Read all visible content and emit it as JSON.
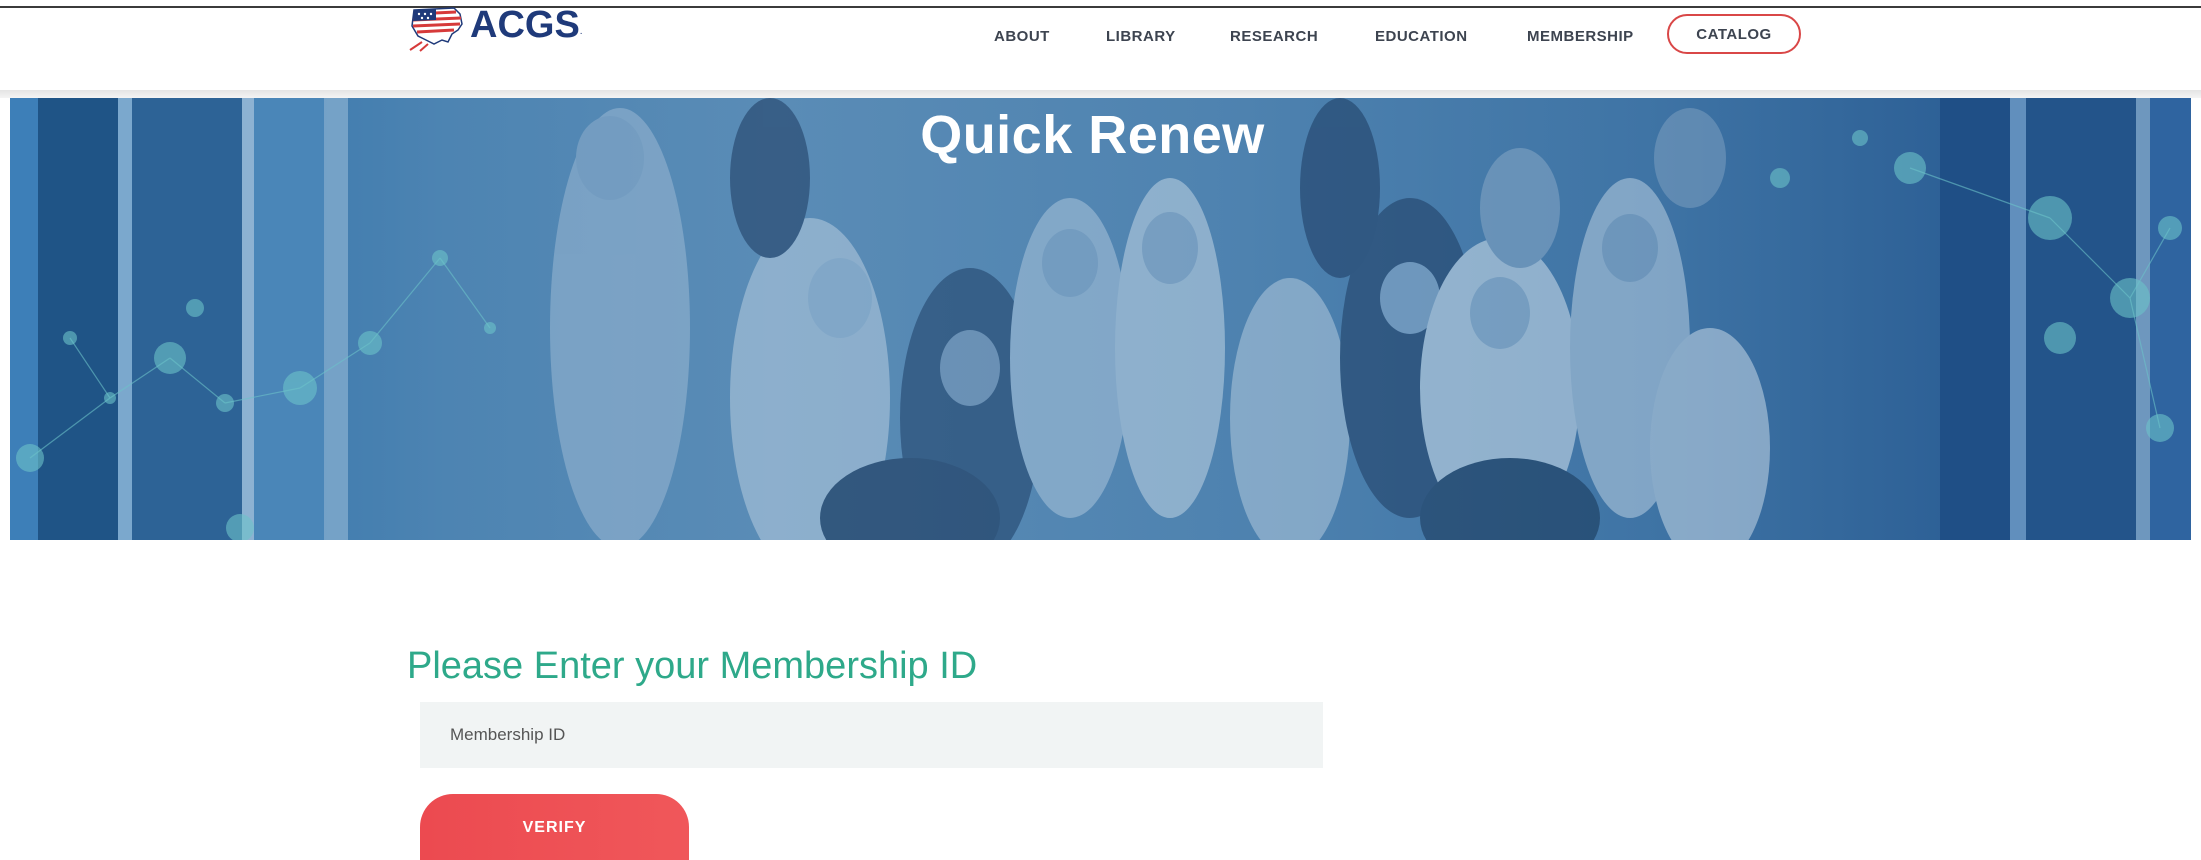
{
  "header": {
    "logo_text": "ACGS",
    "logo_mark": ".",
    "nav": [
      {
        "label": "ABOUT"
      },
      {
        "label": "LIBRARY"
      },
      {
        "label": "RESEARCH"
      },
      {
        "label": "EDUCATION"
      },
      {
        "label": "MEMBERSHIP"
      },
      {
        "label": "CATALOG"
      }
    ]
  },
  "hero": {
    "title": "Quick Renew"
  },
  "form": {
    "heading": "Please Enter your Membership ID",
    "input_placeholder": "Membership ID",
    "input_value": "",
    "verify_label": "VERIFY"
  },
  "colors": {
    "accent_green": "#2ea98a",
    "button_red": "#ec4a50",
    "nav_text": "#3d4450",
    "logo_blue": "#1f3a7a",
    "catalog_border": "#d94747"
  },
  "icons": {
    "logo": "us-flag-map-icon"
  }
}
